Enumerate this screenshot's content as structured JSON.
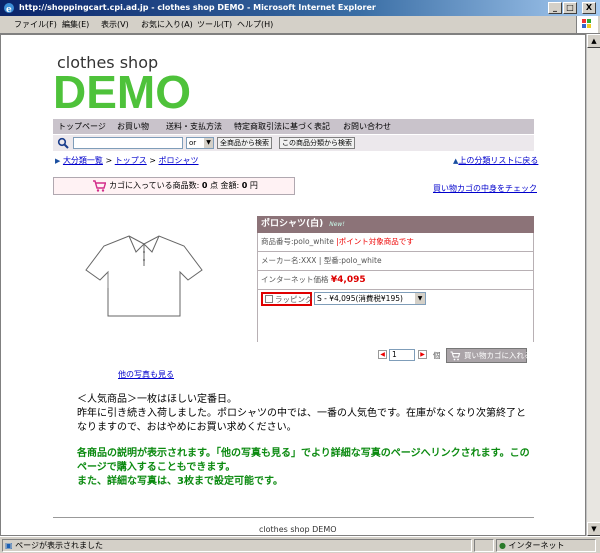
{
  "window": {
    "title": "http://shoppingcart.cpi.ad.jp - clothes shop DEMO - Microsoft Internet Explorer",
    "minimize": "_",
    "maximize": "□",
    "close": "X"
  },
  "menu": [
    "ファイル(F)",
    "編集(E)",
    "表示(V)",
    "お気に入り(A)",
    "ツール(T)",
    "ヘルプ(H)"
  ],
  "logo": {
    "small": "clothes shop",
    "big": "DEMO"
  },
  "nav": [
    "トップページ",
    "お買い物",
    "送料・支払方法",
    "特定商取引法に基づく表記",
    "お問い合わせ"
  ],
  "search": {
    "value": "",
    "mode": "or",
    "btn_all": "全商品から検索",
    "btn_cat": "この商品分類から検索"
  },
  "breadcrumb": {
    "items": [
      "大分類一覧",
      "トップス",
      "ポロシャツ"
    ],
    "sep": ">",
    "up_link": "上の分類リストに戻る"
  },
  "cart": {
    "label": "カゴに入っている商品数:",
    "count": "0",
    "count_unit": "点",
    "amount_label": "金額:",
    "amount": "0",
    "amount_unit": "円",
    "check_link": "買い物カゴの中身をチェック"
  },
  "product": {
    "name": "ポロシャツ(白)",
    "badge": "New!",
    "code_label": "商品番号:polo_white",
    "point_note": "|ポイント対象商品です",
    "maker_line": "メーカー名:XXX | 型番:polo_white",
    "price_label": "インターネット価格",
    "price": "¥4,095",
    "wrapping": "ラッピング",
    "option_selected": "S - ¥4,095(消費税¥195)",
    "qty": "1",
    "unit": "個",
    "add_to_cart": "買い物カゴに入れる",
    "more_photos": "他の写真も見る"
  },
  "description": {
    "p1": "＜人気商品＞一枚はほしい定番日。",
    "p2": "昨年に引き続き入荷しました。ポロシャツの中では、一番の人気色です。在庫がなくなり次第終了となりますので、おはやめにお買い求めください。",
    "g1": "各商品の説明が表示されます。「他の写真も見る」でより詳細な写真のページへリンクされます。このページで購入することもできます。",
    "g2": "また、詳細な写真は、3枚まで設定可能です。"
  },
  "footer": "clothes shop DEMO",
  "status": {
    "message": "ページが表示されました",
    "zone": "インターネット"
  },
  "colors": {
    "logo_green": "#4ec23a",
    "nav_bg": "#c9c3cb",
    "product_header": "#8c7378",
    "desc_green": "#0b8a10",
    "price_red": "#dd0000"
  }
}
